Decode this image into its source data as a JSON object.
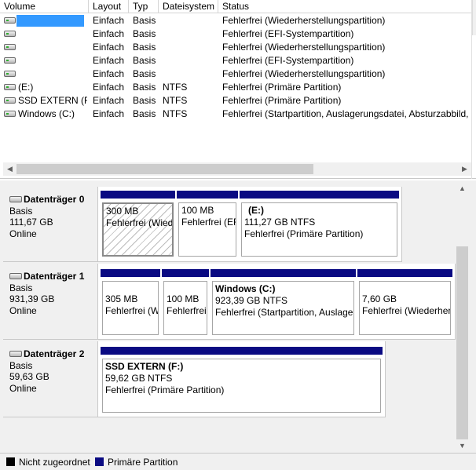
{
  "columns": [
    "Volume",
    "Layout",
    "Typ",
    "Dateisystem",
    "Status"
  ],
  "volumes": [
    {
      "volume": "",
      "layout": "Einfach",
      "typ": "Basis",
      "fs": "",
      "status": "Fehlerfrei (Wiederherstellungspartition)"
    },
    {
      "volume": "",
      "layout": "Einfach",
      "typ": "Basis",
      "fs": "",
      "status": "Fehlerfrei (EFI-Systempartition)"
    },
    {
      "volume": "",
      "layout": "Einfach",
      "typ": "Basis",
      "fs": "",
      "status": "Fehlerfrei (Wiederherstellungspartition)"
    },
    {
      "volume": "",
      "layout": "Einfach",
      "typ": "Basis",
      "fs": "",
      "status": "Fehlerfrei (EFI-Systempartition)"
    },
    {
      "volume": "",
      "layout": "Einfach",
      "typ": "Basis",
      "fs": "",
      "status": "Fehlerfrei (Wiederherstellungspartition)"
    },
    {
      "volume": "(E:)",
      "layout": "Einfach",
      "typ": "Basis",
      "fs": "NTFS",
      "status": "Fehlerfrei (Primäre Partition)"
    },
    {
      "volume": "SSD EXTERN (F:)",
      "layout": "Einfach",
      "typ": "Basis",
      "fs": "NTFS",
      "status": "Fehlerfrei (Primäre Partition)"
    },
    {
      "volume": "Windows (C:)",
      "layout": "Einfach",
      "typ": "Basis",
      "fs": "NTFS",
      "status": "Fehlerfrei (Startpartition, Auslagerungsdatei, Absturzabbild, Prim"
    }
  ],
  "disks": [
    {
      "name": "Datenträger 0",
      "type": "Basis",
      "size": "111,67 GB",
      "state": "Online",
      "partitions": [
        {
          "name": "",
          "size": "300 MB",
          "status": "Fehlerfrei (Wiederherstellungspartition)"
        },
        {
          "name": "",
          "size": "100 MB",
          "status": "Fehlerfrei (EFI-Systempartition)"
        },
        {
          "name": "(E:)",
          "size": "111,27 GB NTFS",
          "status": "Fehlerfrei (Primäre Partition)"
        }
      ]
    },
    {
      "name": "Datenträger 1",
      "type": "Basis",
      "size": "931,39 GB",
      "state": "Online",
      "partitions": [
        {
          "name": "",
          "size": "305 MB",
          "status": "Fehlerfrei (Wiederherstellungspartition)"
        },
        {
          "name": "",
          "size": "100 MB",
          "status": "Fehlerfrei (EFI-Systempartition)"
        },
        {
          "name": "Windows  (C:)",
          "size": "923,39 GB NTFS",
          "status": "Fehlerfrei (Startpartition, Auslagerungsdatei, Absturzabbild)"
        },
        {
          "name": "",
          "size": "7,60 GB",
          "status": "Fehlerfrei (Wiederherstellungspartition)"
        }
      ]
    },
    {
      "name": "Datenträger 2",
      "type": "Basis",
      "size": "59,63 GB",
      "state": "Online",
      "partitions": [
        {
          "name": "SSD EXTERN  (F:)",
          "size": "59,62 GB NTFS",
          "status": "Fehlerfrei (Primäre Partition)"
        }
      ]
    }
  ],
  "legend": [
    {
      "label": "Nicht zugeordnet",
      "color": "#000000"
    },
    {
      "label": "Primäre Partition",
      "color": "#0a0a82"
    }
  ],
  "icons": {
    "volume": "drive-icon",
    "disk": "disk-icon",
    "scroll_left": "arrow-left-icon",
    "scroll_right": "arrow-right-icon",
    "scroll_up": "arrow-up-icon",
    "scroll_down": "arrow-down-icon"
  }
}
